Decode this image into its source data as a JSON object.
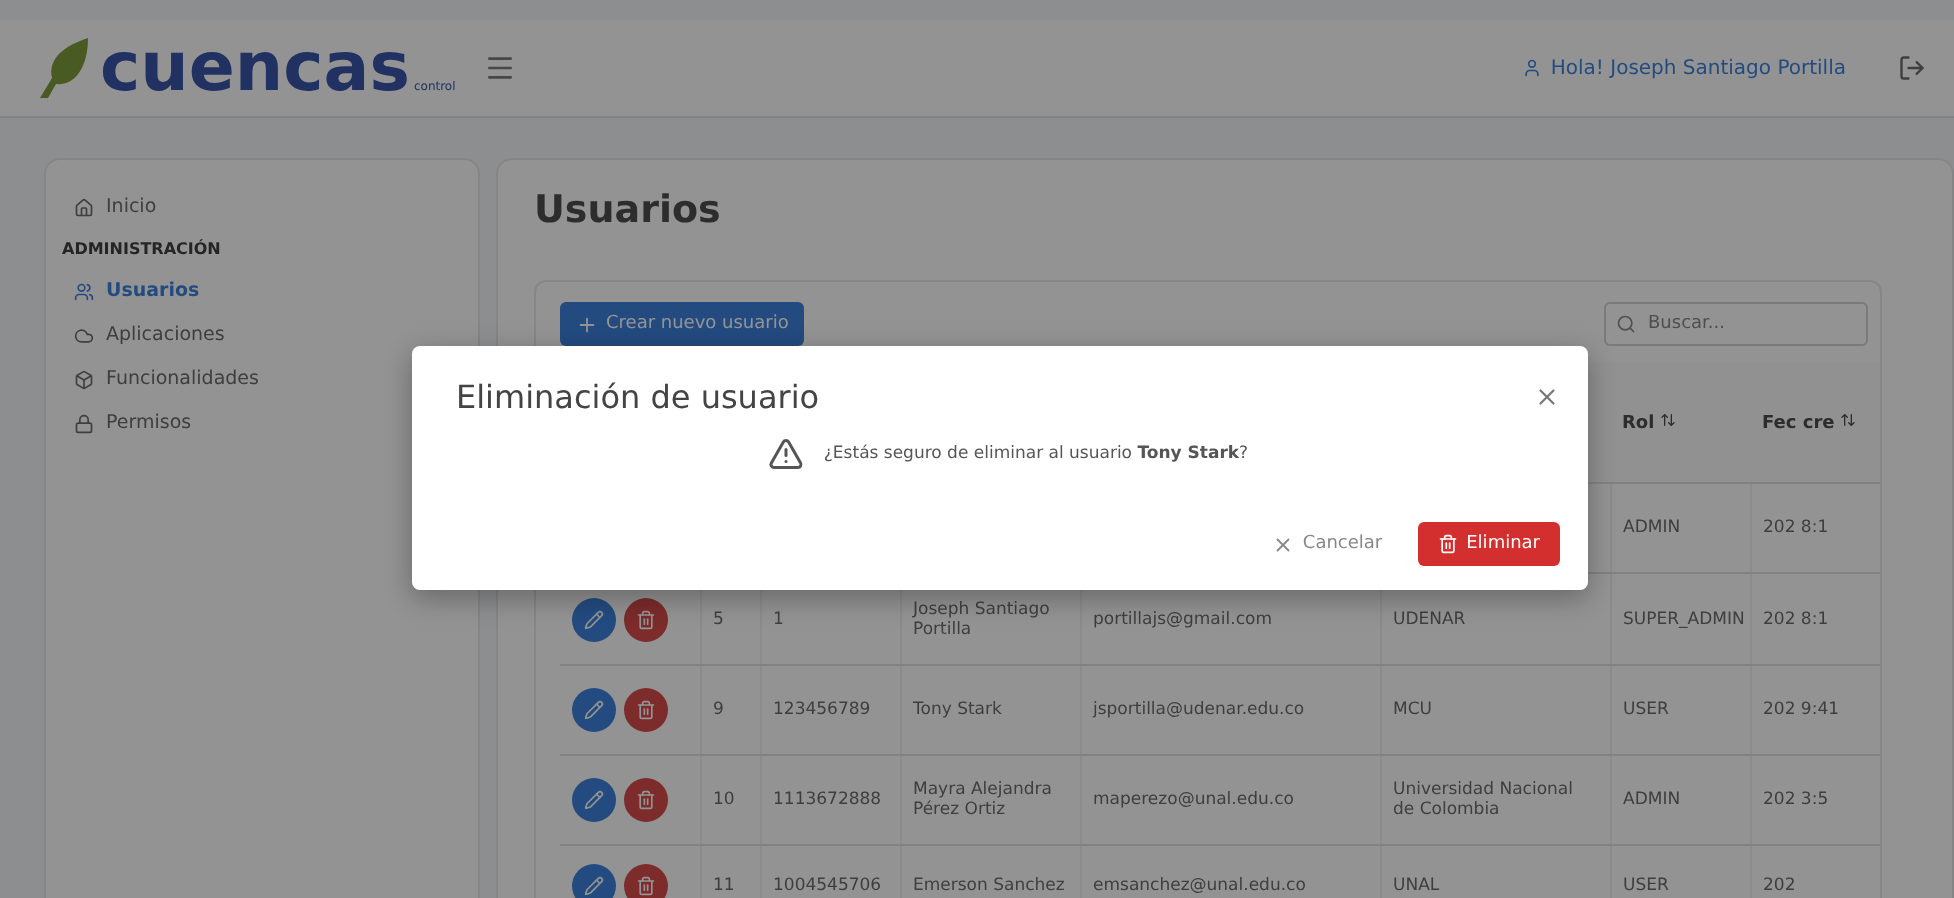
{
  "header": {
    "logo": "cuencas",
    "logo_sub": "control",
    "greeting": "Hola! Joseph Santiago Portilla"
  },
  "sidebar": {
    "items": [
      {
        "label": "Inicio",
        "kind": "link",
        "selected": false
      },
      {
        "label": "ADMINISTRACIÓN",
        "kind": "section",
        "selected": false
      },
      {
        "label": "Usuarios",
        "kind": "link",
        "selected": true
      },
      {
        "label": "Aplicaciones",
        "kind": "link",
        "selected": false
      },
      {
        "label": "Funcionalidades",
        "kind": "link",
        "selected": false
      },
      {
        "label": "Permisos",
        "kind": "link",
        "selected": false
      }
    ]
  },
  "page": {
    "title": "Usuarios",
    "create_button": "Crear nuevo usuario",
    "search": {
      "placeholder": "Buscar..."
    }
  },
  "table": {
    "columns": [
      "",
      "",
      "",
      "",
      "",
      "Rol",
      "Fec cre"
    ],
    "rows": [
      {
        "cells": [
          "",
          "",
          "",
          "",
          "",
          "ADMIN",
          "202 8:1"
        ]
      },
      {
        "cells": [
          "5",
          "1",
          "Joseph Santiago Portilla",
          "portillajs@gmail.com",
          "UDENAR",
          "SUPER_ADMIN",
          "202 8:1"
        ]
      },
      {
        "cells": [
          "9",
          "123456789",
          "Tony Stark",
          "jsportilla@udenar.edu.co",
          "MCU",
          "USER",
          "202 9:41"
        ]
      },
      {
        "cells": [
          "10",
          "1113672888",
          "Mayra Alejandra Pérez Ortiz",
          "maperezo@unal.edu.co",
          "Universidad Nacional de Colombia",
          "ADMIN",
          "202 3:5"
        ]
      },
      {
        "cells": [
          "11",
          "1004545706",
          "Emerson Sanchez",
          "emsanchez@unal.edu.co",
          "UNAL",
          "USER",
          "202"
        ]
      }
    ]
  },
  "dialog": {
    "title": "Eliminación de usuario",
    "message": "¿Estás seguro de eliminar al usuario **Tony Stark**?",
    "cancel": "Cancelar",
    "confirm": "Eliminar"
  }
}
